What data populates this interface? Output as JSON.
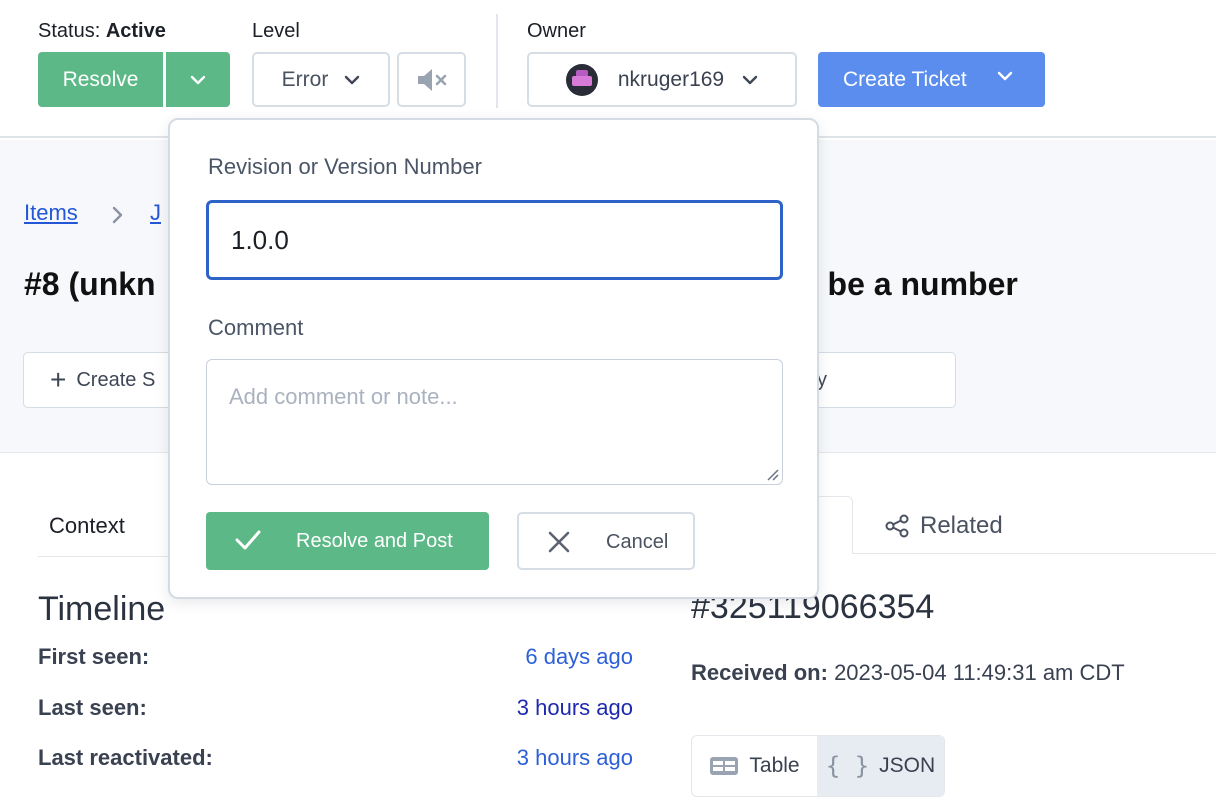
{
  "toolbar": {
    "status_label": "Status:",
    "status_value": "Active",
    "resolve_label": "Resolve",
    "level_label": "Level",
    "level_value": "Error",
    "owner_label": "Owner",
    "owner_value": "nkruger169",
    "create_ticket_label": "Create Ticket"
  },
  "breadcrumb": {
    "items_link": "Items",
    "second_link": "J"
  },
  "item": {
    "title_visible_left": "#8 (unkn",
    "title_visible_right": "t be a number"
  },
  "actions": {
    "create_label": "Create S",
    "second_label_fragment": "y"
  },
  "popover": {
    "version_label": "Revision or Version Number",
    "version_value": "1.0.0",
    "comment_label": "Comment",
    "comment_placeholder": "Add comment or note...",
    "resolve_post_label": "Resolve and Post",
    "cancel_label": "Cancel"
  },
  "tabs": {
    "context": "Context",
    "related": "Related"
  },
  "timeline": {
    "title": "Timeline",
    "rows": [
      {
        "label": "First seen:",
        "value": "6 days ago"
      },
      {
        "label": "Last seen:",
        "value": "3 hours ago"
      },
      {
        "label": "Last reactivated:",
        "value": "3 hours ago"
      }
    ]
  },
  "occurrence": {
    "id": "#325119066354",
    "received_label": "Received on:",
    "received_value": "2023-05-04 11:49:31 am CDT",
    "view_table": "Table",
    "view_json": "JSON",
    "active_view": "JSON"
  },
  "colors": {
    "resolve_green": "#5cb887",
    "ticket_blue": "#5b8def",
    "link_blue": "#2457d6",
    "input_focus": "#2d62c8"
  },
  "icons": {
    "resolve_caret": "chevron-down-icon",
    "level_caret": "chevron-down-icon",
    "mute": "speaker-mute-icon",
    "owner_caret": "chevron-down-icon",
    "ticket_caret": "chevron-down-icon",
    "breadcrumb_separator": "chevron-right-icon",
    "create_plus": "plus-icon",
    "post_check": "checkmark-icon",
    "cancel_x": "close-icon",
    "related": "share-nodes-icon",
    "table": "table-icon",
    "json": "braces-icon"
  }
}
